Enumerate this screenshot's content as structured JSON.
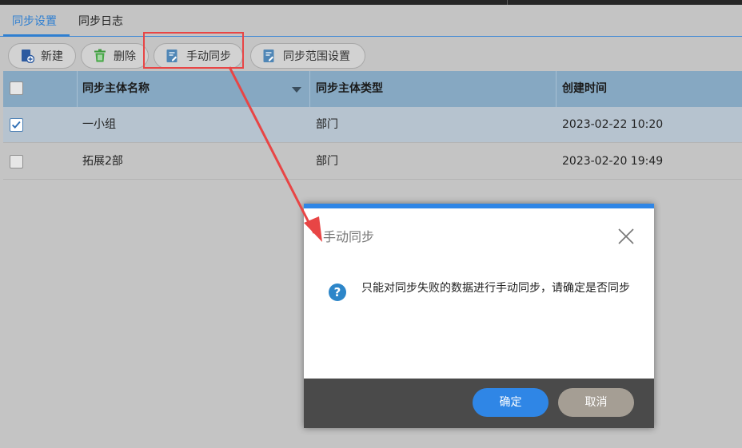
{
  "tabs": [
    {
      "label": "同步设置",
      "active": true
    },
    {
      "label": "同步日志",
      "active": false
    }
  ],
  "toolbar": {
    "new_label": "新建",
    "delete_label": "删除",
    "manual_sync_label": "手动同步",
    "sync_scope_label": "同步范围设置"
  },
  "table": {
    "headers": [
      "同步主体名称",
      "同步主体类型",
      "创建时间"
    ],
    "rows": [
      {
        "name": "一小组",
        "type": "部门",
        "created": "2023-02-22 10:20",
        "checked": true
      },
      {
        "name": "拓展2部",
        "type": "部门",
        "created": "2023-02-20 19:49",
        "checked": false
      }
    ]
  },
  "dialog": {
    "title": "手动同步",
    "message": "只能对同步失败的数据进行手动同步，请确定是否同步",
    "ok_label": "确定",
    "cancel_label": "取消"
  },
  "colors": {
    "accent": "#2f86e6",
    "highlight": "#e84545",
    "header_bg": "#86a8c2"
  }
}
